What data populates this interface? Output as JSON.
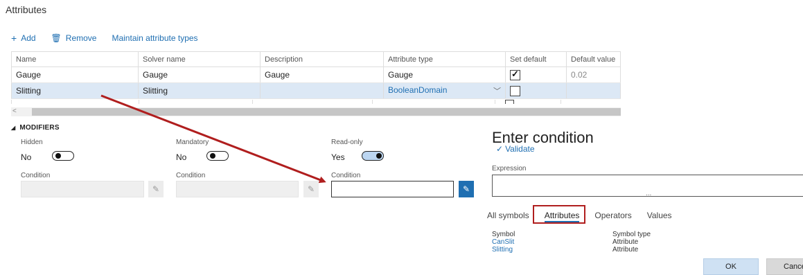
{
  "page": {
    "title": "Attributes"
  },
  "toolbar": {
    "add_icon": "plus-icon",
    "add_label": "Add",
    "remove_icon": "trash-icon",
    "remove_label": "Remove",
    "maintain_label": "Maintain attribute types"
  },
  "grid": {
    "headers": [
      "Name",
      "Solver name",
      "Description",
      "Attribute type",
      "Set default",
      "Default value"
    ],
    "rows": [
      {
        "name": "Gauge",
        "solver": "Gauge",
        "description": "Gauge",
        "type": "Gauge",
        "set_default": true,
        "default_value": "0.02",
        "selected": false
      },
      {
        "name": "Slitting",
        "solver": "Slitting",
        "description": "",
        "type": "BooleanDomain",
        "set_default": false,
        "default_value": "",
        "selected": true
      }
    ]
  },
  "modifiers": {
    "header": "MODIFIERS",
    "hidden": {
      "label": "Hidden",
      "value": "No",
      "on": false
    },
    "mandatory": {
      "label": "Mandatory",
      "value": "No",
      "on": false
    },
    "readonly": {
      "label": "Read-only",
      "value": "Yes",
      "on": true
    },
    "condition_label": "Condition"
  },
  "condition_panel": {
    "title": "Enter condition",
    "validate_label": "Validate",
    "expression_label": "Expression",
    "ellipsis": "...",
    "tabs": [
      "All symbols",
      "Attributes",
      "Operators",
      "Values"
    ],
    "active_tab": "Attributes",
    "symbol_header": "Symbol",
    "type_header": "Symbol type",
    "symbols": [
      {
        "symbol": "CanSlit",
        "type": "Attribute"
      },
      {
        "symbol": "Slitting",
        "type": "Attribute"
      }
    ],
    "ok_label": "OK",
    "cancel_label": "Cance"
  },
  "colors": {
    "accent": "#1f6fb2",
    "selected_row": "#dce8f5",
    "annotation_red": "#b01e1e"
  }
}
